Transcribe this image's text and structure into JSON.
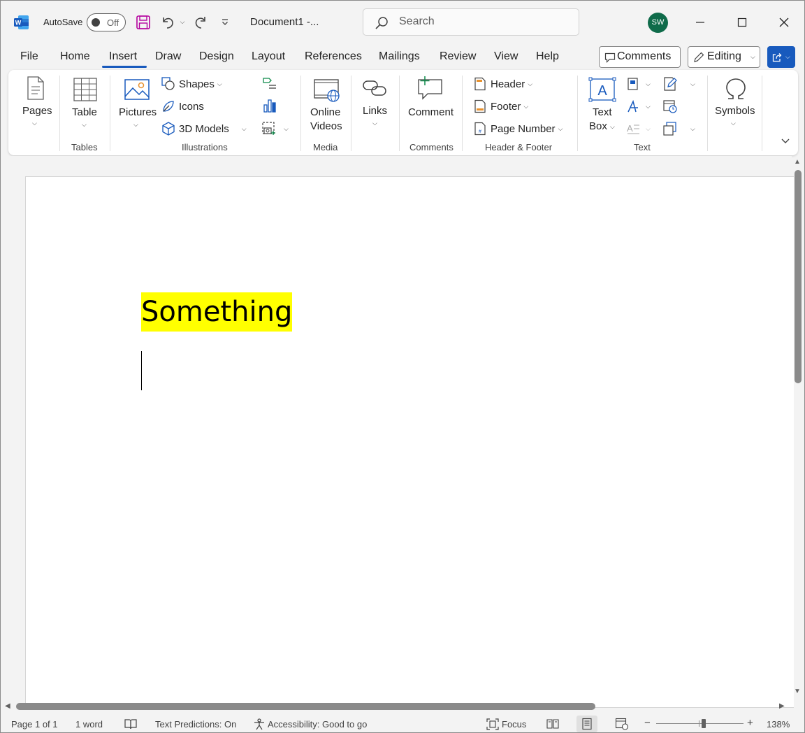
{
  "titlebar": {
    "autosave_label": "AutoSave",
    "autosave_state": "Off",
    "document_title": "Document1  -...",
    "search_placeholder": "Search",
    "user_initials": "SW"
  },
  "tabs": [
    "File",
    "Home",
    "Insert",
    "Draw",
    "Design",
    "Layout",
    "References",
    "Mailings",
    "Review",
    "View",
    "Help"
  ],
  "active_tab": "Insert",
  "actions": {
    "comments_label": "Comments",
    "editing_label": "Editing"
  },
  "ribbon": {
    "pages": "Pages",
    "table": "Table",
    "pictures": "Pictures",
    "shapes": "Shapes",
    "icons": "Icons",
    "models": "3D Models",
    "online_videos_1": "Online",
    "online_videos_2": "Videos",
    "links": "Links",
    "comment": "Comment",
    "header": "Header",
    "footer": "Footer",
    "page_number": "Page Number",
    "text_box_1": "Text",
    "text_box_2": "Box",
    "symbols": "Symbols",
    "groups": {
      "tables": "Tables",
      "illustrations": "Illustrations",
      "media": "Media",
      "comments": "Comments",
      "header_footer": "Header & Footer",
      "text": "Text"
    }
  },
  "document": {
    "body_text": "Something",
    "highlight_color": "#ffff00"
  },
  "statusbar": {
    "page": "Page 1 of 1",
    "words": "1 word",
    "text_predictions": "Text Predictions: On",
    "accessibility": "Accessibility: Good to go",
    "focus": "Focus",
    "zoom": "138%",
    "zoom_minus": "−",
    "zoom_plus": "+"
  },
  "colors": {
    "accent": "#185abd",
    "avatar": "#0f6b4a",
    "word_icon": "#185abd",
    "save_icon": "#b4009e"
  }
}
